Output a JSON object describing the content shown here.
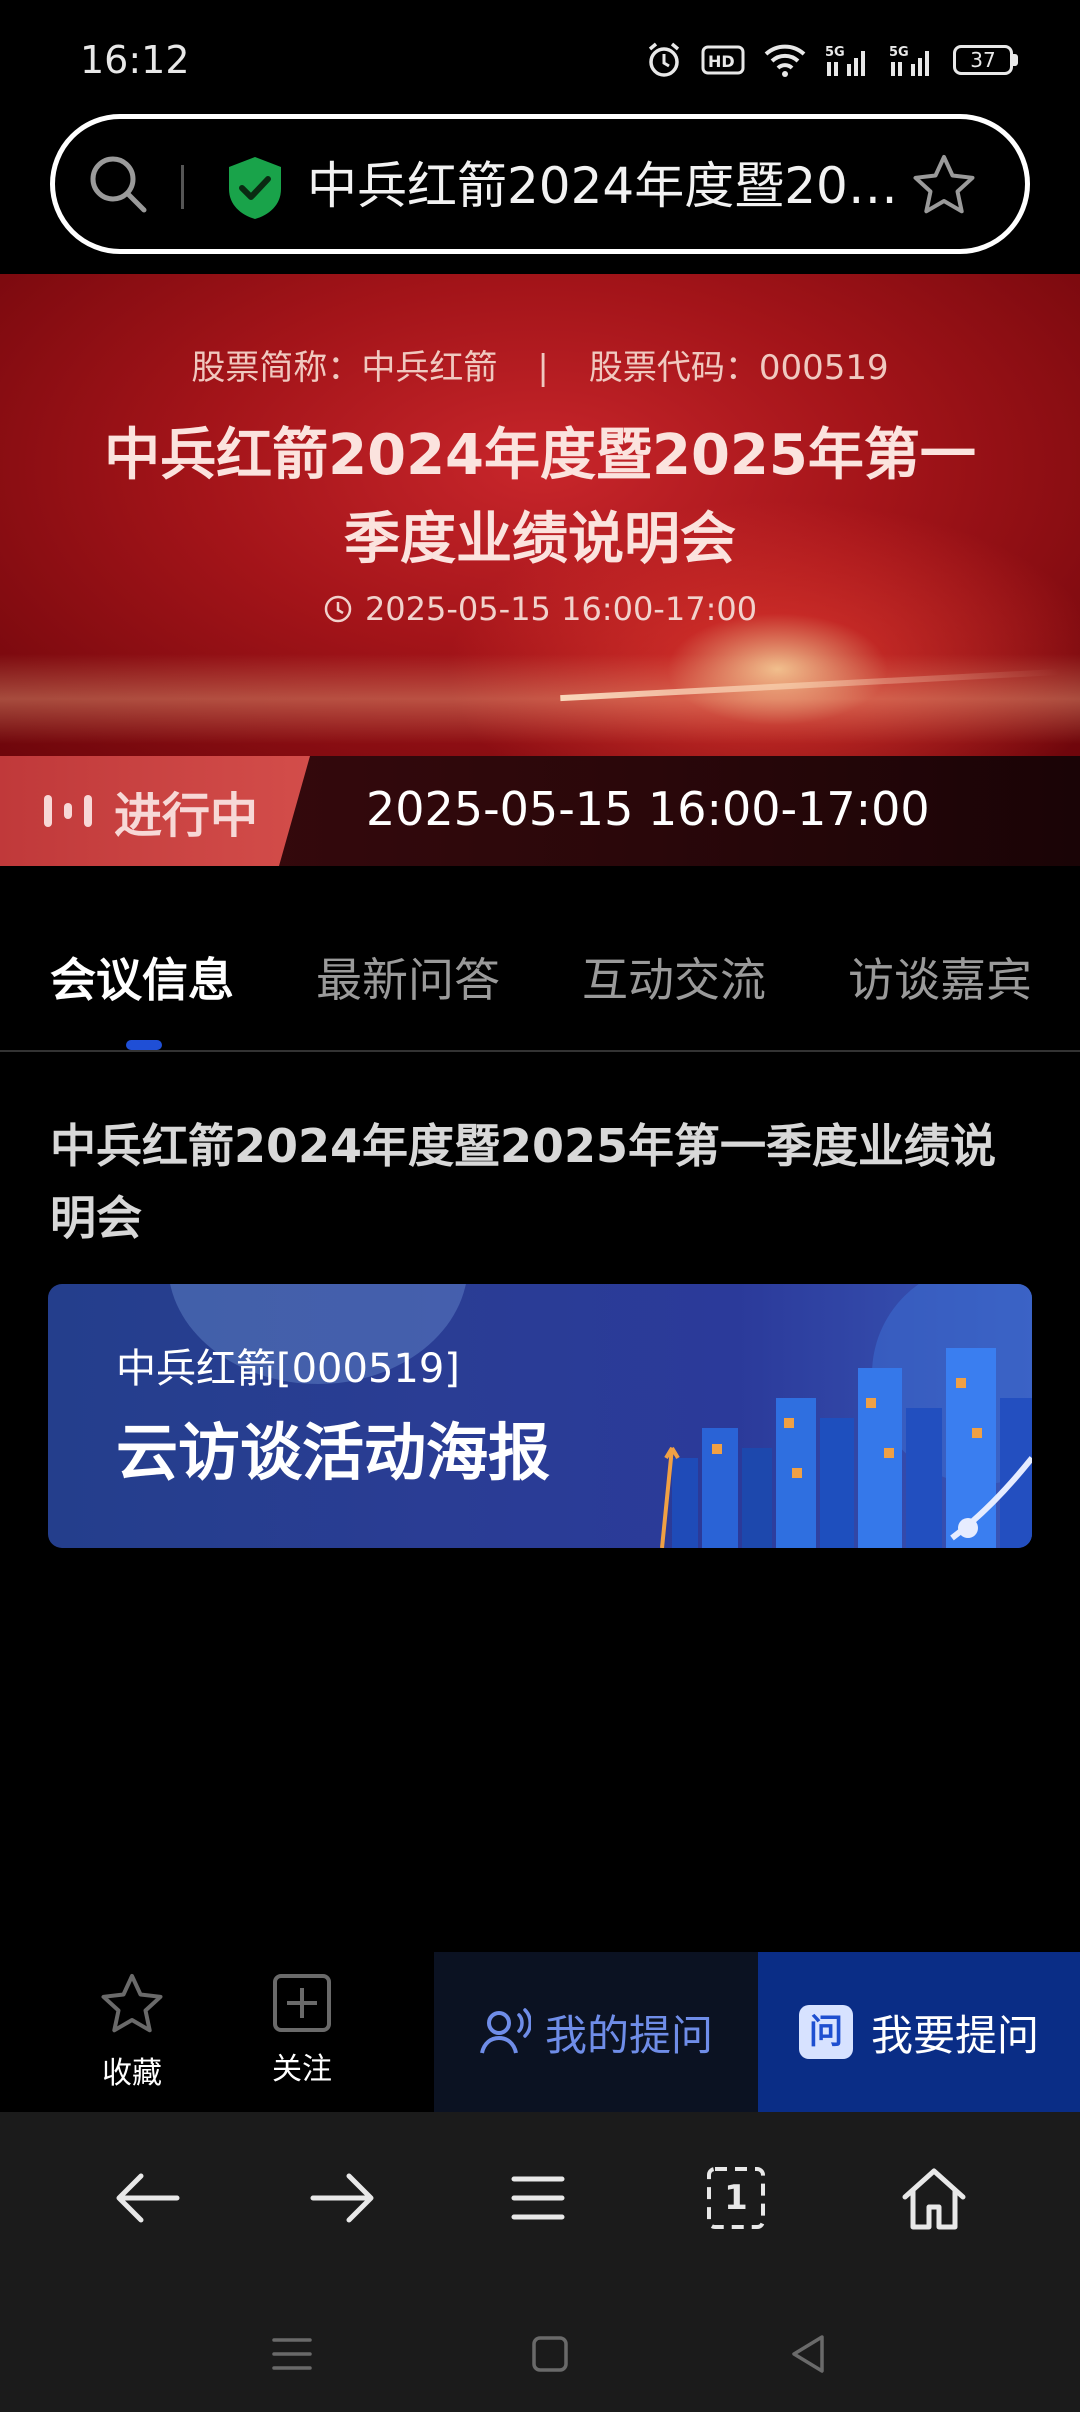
{
  "status_bar": {
    "time": "16:12",
    "battery": "37"
  },
  "address_bar": {
    "title": "中兵红箭2024年度暨202..."
  },
  "banner": {
    "stock_name": "股票简称：中兵红箭",
    "separator": "|",
    "stock_code": "股票代码：000519",
    "title": "中兵红箭2024年度暨2025年第一季度业绩说明会",
    "time": "2025-05-15  16:00-17:00"
  },
  "live_status": {
    "label": "进行中",
    "time": "2025-05-15 16:00-17:00"
  },
  "tabs": [
    {
      "label": "会议信息",
      "active": true
    },
    {
      "label": "最新问答",
      "active": false
    },
    {
      "label": "互动交流",
      "active": false
    },
    {
      "label": "访谈嘉宾",
      "active": false
    }
  ],
  "content": {
    "meeting_title": "中兵红箭2024年度暨2025年第一季度业绩说明会",
    "poster": {
      "company": "中兵红箭[000519]",
      "title": "云访谈活动海报"
    }
  },
  "action_bar": {
    "favorite_label": "收藏",
    "follow_label": "关注",
    "my_questions_label": "我的提问",
    "ask_badge": "问",
    "ask_label": "我要提问"
  },
  "browser_nav": {
    "tab_count": "1"
  },
  "colors": {
    "accent_blue": "#1f4fd6",
    "ask_button_bg": "#0a2d86",
    "live_badge": "#c0393a",
    "shield_green": "#19a34a"
  },
  "icons": [
    "alarm-icon",
    "hd-icon",
    "wifi-icon",
    "signal-5g-icon",
    "battery-icon",
    "search-icon",
    "shield-check-icon",
    "star-icon",
    "clock-icon",
    "live-bars-icon",
    "plus-square-icon",
    "user-voice-icon",
    "back-arrow-icon",
    "forward-arrow-icon",
    "menu-icon",
    "tabs-icon",
    "home-icon"
  ]
}
